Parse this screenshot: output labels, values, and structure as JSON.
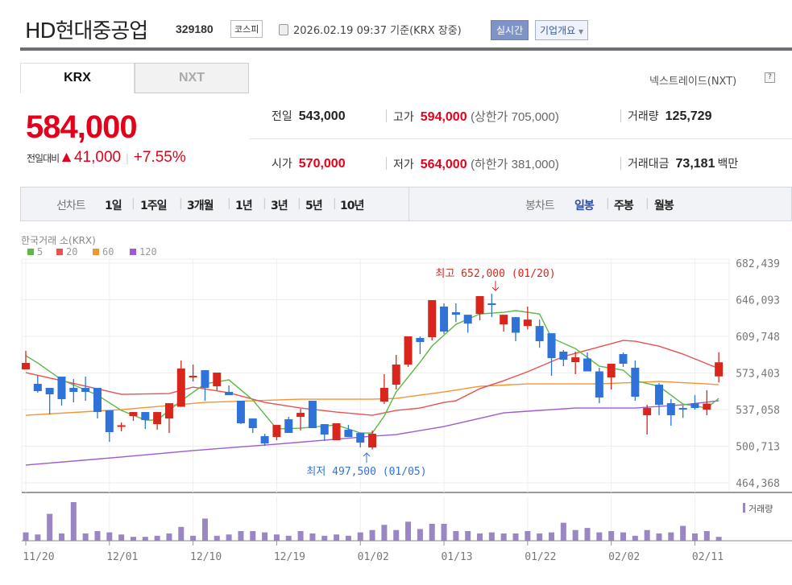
{
  "header": {
    "title": "HD현대중공업",
    "code": "329180",
    "market": "코스피",
    "timestamp": "2026.02.19 09:37 기준(KRX 장중)",
    "realtime": "실시간",
    "company_info": "기업개요"
  },
  "tabs": [
    {
      "label": "KRX",
      "active": true
    },
    {
      "label": "NXT",
      "active": false
    }
  ],
  "nxt_link": "넥스트레이드(NXT)",
  "help": "?",
  "price": {
    "current": "584,000",
    "change_label": "전일대비",
    "change": "41,000",
    "change_pct": "+7.55%",
    "up_color": "#e4001b"
  },
  "stats": {
    "prev_label": "전일",
    "prev": "543,000",
    "high_label": "고가",
    "high": "594,000",
    "upper_limit": "(상한가 705,000)",
    "volume_label": "거래량",
    "volume": "125,729",
    "open_label": "시가",
    "open": "570,000",
    "low_label": "저가",
    "low": "564,000",
    "lower_limit": "(하한가 381,000)",
    "amount_label": "거래대금",
    "amount": "73,181",
    "amount_unit": "백만"
  },
  "chart_tabs": {
    "line_label": "선차트",
    "line": [
      "1일",
      "1주일",
      "3개월",
      "1년",
      "3년",
      "5년",
      "10년"
    ],
    "candle_label": "봉차트",
    "candle": [
      "일봉",
      "주봉",
      "월봉"
    ],
    "active_candle": "일봉"
  },
  "chart_data": {
    "type": "candlestick",
    "exchange": "한국거래 소(KRX)",
    "legend": [
      {
        "name": "5",
        "color": "#5cb946"
      },
      {
        "name": "20",
        "color": "#ea5050"
      },
      {
        "name": "60",
        "color": "#f39430"
      },
      {
        "name": "120",
        "color": "#9c5bd0"
      }
    ],
    "ylim": [
      464368,
      682439
    ],
    "y_ticks": [
      "682,439",
      "646,093",
      "609,748",
      "573,403",
      "537,058",
      "500,713",
      "464,368"
    ],
    "x_ticks": [
      {
        "i": 0,
        "label": "11/20"
      },
      {
        "i": 7,
        "label": "12/01"
      },
      {
        "i": 14,
        "label": "12/10"
      },
      {
        "i": 21,
        "label": "12/19"
      },
      {
        "i": 28,
        "label": "01/02"
      },
      {
        "i": 35,
        "label": "01/13"
      },
      {
        "i": 42,
        "label": "01/22"
      },
      {
        "i": 49,
        "label": "02/02"
      },
      {
        "i": 56,
        "label": "02/11"
      }
    ],
    "ohlc": [
      [
        576971,
        595348,
        576971,
        583363
      ],
      [
        562589,
        570579,
        553800,
        555398
      ],
      [
        558594,
        558594,
        532227,
        552202
      ],
      [
        569780,
        569780,
        541016,
        547408
      ],
      [
        558594,
        567383,
        544212,
        554599
      ],
      [
        558594,
        569780,
        545810,
        554599
      ],
      [
        558594,
        558594,
        528232,
        534624
      ],
      [
        536222,
        536222,
        505061,
        514649
      ],
      [
        521041,
        524237,
        515448,
        521500
      ],
      [
        530630,
        534624,
        525835,
        534624
      ],
      [
        534624,
        534624,
        517845,
        526634
      ],
      [
        522638,
        534624,
        517046,
        534624
      ],
      [
        528232,
        543413,
        513850,
        543413
      ],
      [
        539818,
        585760,
        539818,
        577770
      ],
      [
        570000,
        581765,
        564987,
        570579
      ],
      [
        576172,
        576172,
        545810,
        558594
      ],
      [
        560191,
        573775,
        556196,
        573775
      ],
      [
        554599,
        560990,
        551403,
        551403
      ],
      [
        545810,
        545810,
        522638,
        523437
      ],
      [
        528232,
        528232,
        513850,
        518643
      ],
      [
        510654,
        513051,
        501066,
        503463
      ],
      [
        509856,
        521839,
        506660,
        521839
      ],
      [
        527433,
        529831,
        513850,
        513850
      ],
      [
        529831,
        537820,
        516247,
        533825
      ],
      [
        545810,
        545810,
        518643,
        518643
      ],
      [
        522638,
        522638,
        505862,
        512253
      ],
      [
        506660,
        523437,
        506660,
        523437
      ],
      [
        517046,
        521839,
        509856,
        509856
      ],
      [
        513850,
        513850,
        499471,
        504264
      ],
      [
        499471,
        516247,
        497500,
        513051
      ],
      [
        545011,
        572177,
        542614,
        558594
      ],
      [
        561790,
        591353,
        556995,
        581765
      ],
      [
        581765,
        609730,
        579368,
        609730
      ],
      [
        608132,
        609730,
        592152,
        604137
      ],
      [
        608931,
        645685,
        605735,
        645685
      ],
      [
        639293,
        642489,
        612128,
        614525
      ],
      [
        633700,
        642489,
        624011,
        631203
      ],
      [
        631203,
        631203,
        613327,
        622414
      ],
      [
        632002,
        649680,
        625609,
        649680
      ],
      [
        642489,
        652000,
        628806,
        640891
      ],
      [
        621614,
        631203,
        614525,
        631203
      ],
      [
        628806,
        628806,
        604936,
        613327
      ],
      [
        620016,
        639293,
        616820,
        626408
      ],
      [
        620016,
        626408,
        598443,
        604936
      ],
      [
        612826,
        612826,
        570579,
        588157
      ],
      [
        594550,
        596148,
        580167,
        586559
      ],
      [
        584162,
        594550,
        572177,
        588956
      ],
      [
        587757,
        593751,
        574972,
        574972
      ],
      [
        574972,
        578569,
        543413,
        549006
      ],
      [
        568981,
        582564,
        556995,
        582564
      ],
      [
        592152,
        593751,
        579368,
        582564
      ],
      [
        578569,
        585760,
        545810,
        549805
      ],
      [
        531429,
        541815,
        512253,
        538619
      ],
      [
        561790,
        563388,
        531429,
        541815
      ],
      [
        543413,
        547408,
        521041,
        531429
      ],
      [
        538619,
        541016,
        528832,
        537021
      ],
      [
        543413,
        551403,
        537021,
        538619
      ],
      [
        537021,
        556196,
        531429,
        543000
      ],
      [
        570000,
        594000,
        564000,
        584000
      ]
    ],
    "ma": {
      "5": [
        [
          0,
          590554
        ],
        [
          1,
          583363
        ],
        [
          3,
          566584
        ],
        [
          6,
          551403
        ],
        [
          8,
          536222
        ],
        [
          10,
          526634
        ],
        [
          11,
          526634
        ],
        [
          13,
          545810
        ],
        [
          15,
          562589
        ],
        [
          17,
          566584
        ],
        [
          19,
          546609
        ],
        [
          21,
          517845
        ],
        [
          23,
          518643
        ],
        [
          26,
          521839
        ],
        [
          28,
          513850
        ],
        [
          29,
          513850
        ],
        [
          30,
          530630
        ],
        [
          31,
          554599
        ],
        [
          33,
          584162
        ],
        [
          34,
          600143
        ],
        [
          36,
          621614
        ],
        [
          38,
          632002
        ],
        [
          40,
          633700
        ],
        [
          41,
          635298
        ],
        [
          43,
          632002
        ],
        [
          44,
          608132
        ],
        [
          46,
          597550
        ],
        [
          48,
          580167
        ],
        [
          50,
          576172
        ],
        [
          51,
          565786
        ],
        [
          53,
          560191
        ],
        [
          55,
          542614
        ],
        [
          57,
          538619
        ],
        [
          58,
          548207
        ]
      ],
      "20": [
        [
          0,
          573775
        ],
        [
          3,
          565786
        ],
        [
          8,
          552202
        ],
        [
          12,
          553000
        ],
        [
          14,
          559392
        ],
        [
          17,
          553800
        ],
        [
          20,
          544212
        ],
        [
          23,
          538619
        ],
        [
          26,
          534624
        ],
        [
          29,
          531429
        ],
        [
          31,
          536222
        ],
        [
          33,
          538619
        ],
        [
          35,
          544212
        ],
        [
          36,
          545810
        ],
        [
          38,
          557793
        ],
        [
          40,
          565786
        ],
        [
          42,
          574576
        ],
        [
          45,
          589758
        ],
        [
          47,
          596148
        ],
        [
          49,
          602540
        ],
        [
          50,
          605735
        ],
        [
          51,
          604936
        ],
        [
          53,
          600000
        ],
        [
          55,
          592152
        ],
        [
          57,
          582564
        ],
        [
          58,
          577770
        ]
      ],
      "60": [
        [
          0,
          531429
        ],
        [
          8,
          537021
        ],
        [
          15,
          544212
        ],
        [
          23,
          547408
        ],
        [
          29,
          547408
        ],
        [
          31,
          548207
        ],
        [
          35,
          554599
        ],
        [
          38,
          560191
        ],
        [
          42,
          562589
        ],
        [
          48,
          562589
        ],
        [
          53,
          564987
        ],
        [
          57,
          562589
        ],
        [
          58,
          561790
        ]
      ],
      "120": [
        [
          0,
          481963
        ],
        [
          8,
          489953
        ],
        [
          14,
          496345
        ],
        [
          21,
          502737
        ],
        [
          29,
          510654
        ],
        [
          31,
          512253
        ],
        [
          35,
          520240
        ],
        [
          40,
          533825
        ],
        [
          46,
          538619
        ],
        [
          51,
          538619
        ],
        [
          55,
          541815
        ],
        [
          58,
          545810
        ]
      ]
    },
    "volume_label": "거래량",
    "volume": [
      268800,
      201600,
      865200,
      235200,
      1243200,
      235200,
      310800,
      268800,
      201600,
      126000,
      126000,
      159600,
      235200,
      445200,
      159600,
      714000,
      159600,
      201600,
      310800,
      310800,
      268800,
      201600,
      159600,
      310800,
      235200,
      159600,
      201600,
      159600,
      268800,
      344400,
      512400,
      344400,
      613200,
      378000,
      546000,
      546000,
      310800,
      310800,
      235200,
      268800,
      235200,
      235200,
      310800,
      235200,
      268800,
      579600,
      344400,
      411600,
      268800,
      310800,
      268800,
      159600,
      344400,
      235200,
      268800,
      478800,
      235200,
      310800,
      125729
    ],
    "annotations": {
      "high": "최고 652,000 (01/20)",
      "low": "최저 497,500 (01/05)"
    }
  }
}
